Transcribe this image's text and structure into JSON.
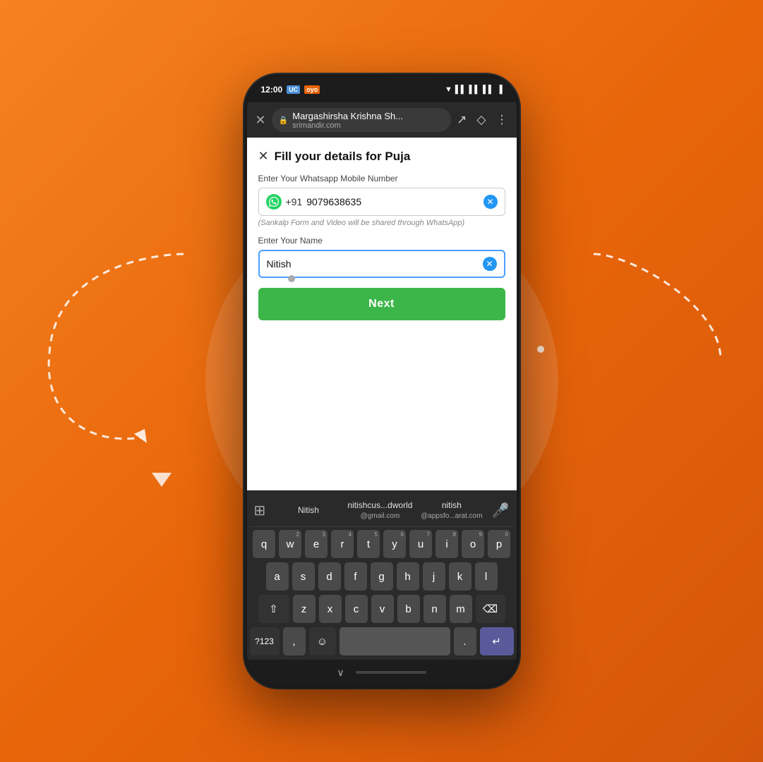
{
  "background": {
    "gradient_start": "#f5821f",
    "gradient_end": "#d4560a"
  },
  "status_bar": {
    "time": "12:00",
    "badge1": "UC",
    "badge2": "oyo",
    "wifi_icon": "📶",
    "battery_icon": "🔋"
  },
  "browser": {
    "title": "Margashirsha Krishna Sh...",
    "domain": "srimandir.com",
    "close_label": "✕",
    "share_icon": "share",
    "bookmark_icon": "bookmark",
    "menu_icon": "⋮"
  },
  "form": {
    "close_icon": "✕",
    "title": "Fill your details for Puja",
    "phone_label": "Enter Your Whatsapp Mobile Number",
    "phone_code": "+91",
    "phone_number": "9079638635",
    "phone_hint": "(Sankalp Form and Video will be shared through WhatsApp)",
    "name_label": "Enter Your Name",
    "name_value": "Nitish",
    "next_button": "Next"
  },
  "keyboard": {
    "suggestions": [
      {
        "main": "Nitish",
        "sub": ""
      },
      {
        "main": "nitishcus...dworld",
        "sub": "@gmail.com"
      },
      {
        "main": "nitish",
        "sub": "@appsfo...arat.com"
      }
    ],
    "rows": [
      [
        "q",
        "w",
        "e",
        "r",
        "t",
        "y",
        "u",
        "i",
        "o",
        "p"
      ],
      [
        "a",
        "s",
        "d",
        "f",
        "g",
        "h",
        "j",
        "k",
        "l"
      ],
      [
        "z",
        "x",
        "c",
        "v",
        "b",
        "n",
        "m"
      ],
      []
    ],
    "num_hints": [
      "",
      "2",
      "3",
      "4",
      "5",
      "6",
      "7",
      "8",
      "9",
      "0"
    ],
    "special_keys": {
      "shift": "⇧",
      "backspace": "⌫",
      "numbers": "?123",
      "comma": ",",
      "emoji": "☺",
      "space": "",
      "period": ".",
      "enter": "↵"
    }
  },
  "bottom": {
    "chevron": "∨",
    "home_indicator": ""
  }
}
